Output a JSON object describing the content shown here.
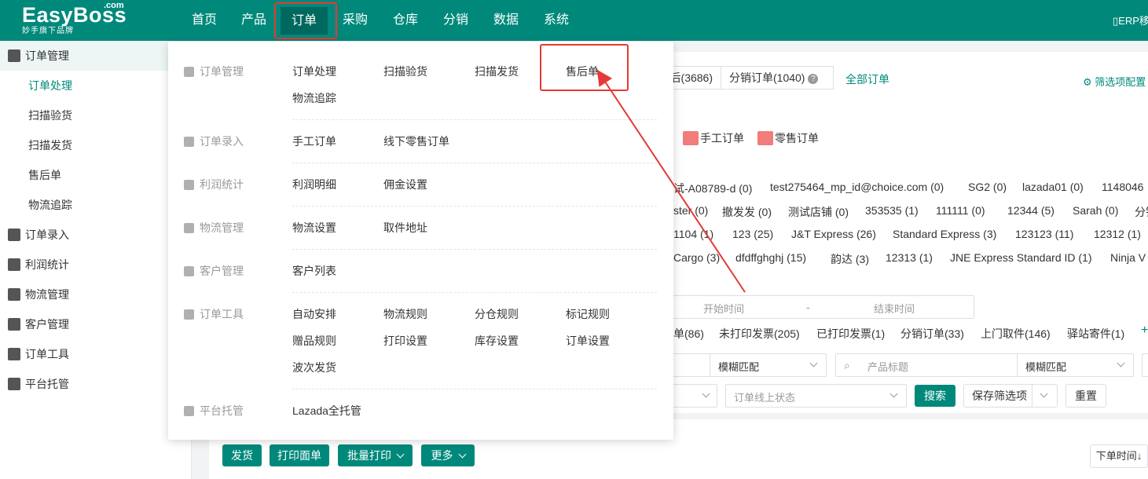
{
  "brand": {
    "name": "EasyBoss",
    "suffix": ".com",
    "sub": "妙手旗下品牌"
  },
  "nav": {
    "items": [
      "首页",
      "产品",
      "订单",
      "采购",
      "仓库",
      "分销",
      "数据",
      "系统"
    ],
    "active": "订单",
    "erp": "ERP移"
  },
  "sidebar": {
    "groups": [
      {
        "label": "订单管理",
        "icon": "clipboard-icon"
      },
      {
        "label": "订单录入",
        "icon": "edit-doc-icon"
      },
      {
        "label": "利润统计",
        "icon": "coins-icon"
      },
      {
        "label": "物流管理",
        "icon": "truck-icon"
      },
      {
        "label": "客户管理",
        "icon": "contact-card-icon"
      },
      {
        "label": "订单工具",
        "icon": "tool-icon"
      },
      {
        "label": "平台托管",
        "icon": "hosting-icon"
      }
    ],
    "sub_items": [
      "订单处理",
      "扫描验货",
      "扫描发货",
      "售后单",
      "物流追踪"
    ],
    "active_sub": "订单处理"
  },
  "dropdown": {
    "sections": [
      {
        "category": "订单管理",
        "icon": "clipboard-icon",
        "rows": [
          [
            "订单处理",
            "扫描验货",
            "扫描发货",
            "售后单"
          ],
          [
            "物流追踪"
          ]
        ]
      },
      {
        "category": "订单录入",
        "icon": "edit-doc-icon",
        "rows": [
          [
            "手工订单",
            "线下零售订单"
          ]
        ]
      },
      {
        "category": "利润统计",
        "icon": "coins-icon",
        "rows": [
          [
            "利润明细",
            "佣金设置"
          ]
        ]
      },
      {
        "category": "物流管理",
        "icon": "truck-icon",
        "rows": [
          [
            "物流设置",
            "取件地址"
          ]
        ]
      },
      {
        "category": "客户管理",
        "icon": "contact-card-icon",
        "rows": [
          [
            "客户列表"
          ]
        ]
      },
      {
        "category": "订单工具",
        "icon": "tool-icon",
        "rows": [
          [
            "自动安排",
            "物流规则",
            "分仓规则",
            "标记规则"
          ],
          [
            "赠品规则",
            "打印设置",
            "库存设置",
            "订单设置"
          ],
          [
            "波次发货"
          ]
        ]
      },
      {
        "category": "平台托管",
        "icon": "hosting-icon",
        "rows": [
          [
            "Lazada全托管"
          ]
        ]
      }
    ],
    "highlighted": "售后单"
  },
  "main": {
    "tabs": [
      "后(3686)",
      "分销订单(1040)"
    ],
    "all_orders": "全部订单",
    "filter_config": "筛选项配置",
    "order_types": [
      "手工订单",
      "零售订单"
    ],
    "shops_row1": [
      "试-A08789-d (0)",
      "test275464_mp_id@choice.com (0)",
      "SG2 (0)",
      "lazada01 (0)",
      "1148046"
    ],
    "shops_row2": [
      "ster (0)",
      "撤发发 (0)",
      "测试店铺 (0)",
      "353535 (1)",
      "111111 (0)",
      "12344 (5)",
      "Sarah (0)",
      "分销"
    ],
    "logistics_row1": [
      "1104 (1)",
      "123 (25)",
      "J&T Express (26)",
      "Standard Express (3)",
      "123123 (11)",
      "12312 (1)"
    ],
    "logistics_row2": [
      "Cargo (3)",
      "dfdffghghj (15)",
      "韵达 (3)",
      "12313 (1)",
      "JNE Express Standard ID (1)",
      "Ninja V"
    ],
    "date_start": "开始时间",
    "date_sep": "-",
    "date_end": "结束时间",
    "status_tabs": [
      "单(86)",
      "未打印发票(205)",
      "已打印发票(1)",
      "分销订单(33)",
      "上门取件(146)",
      "驿站寄件(1)"
    ],
    "plus": "+",
    "match1": "模糊匹配",
    "product_title_placeholder": "产品标题",
    "match2": "模糊匹配",
    "online_status_placeholder": "订单线上状态",
    "search": "搜索",
    "save_filter": "保存筛选项",
    "reset": "重置",
    "actions": [
      "发货",
      "打印面单",
      "批量打印",
      "更多"
    ],
    "sort": "下单时间↓"
  }
}
